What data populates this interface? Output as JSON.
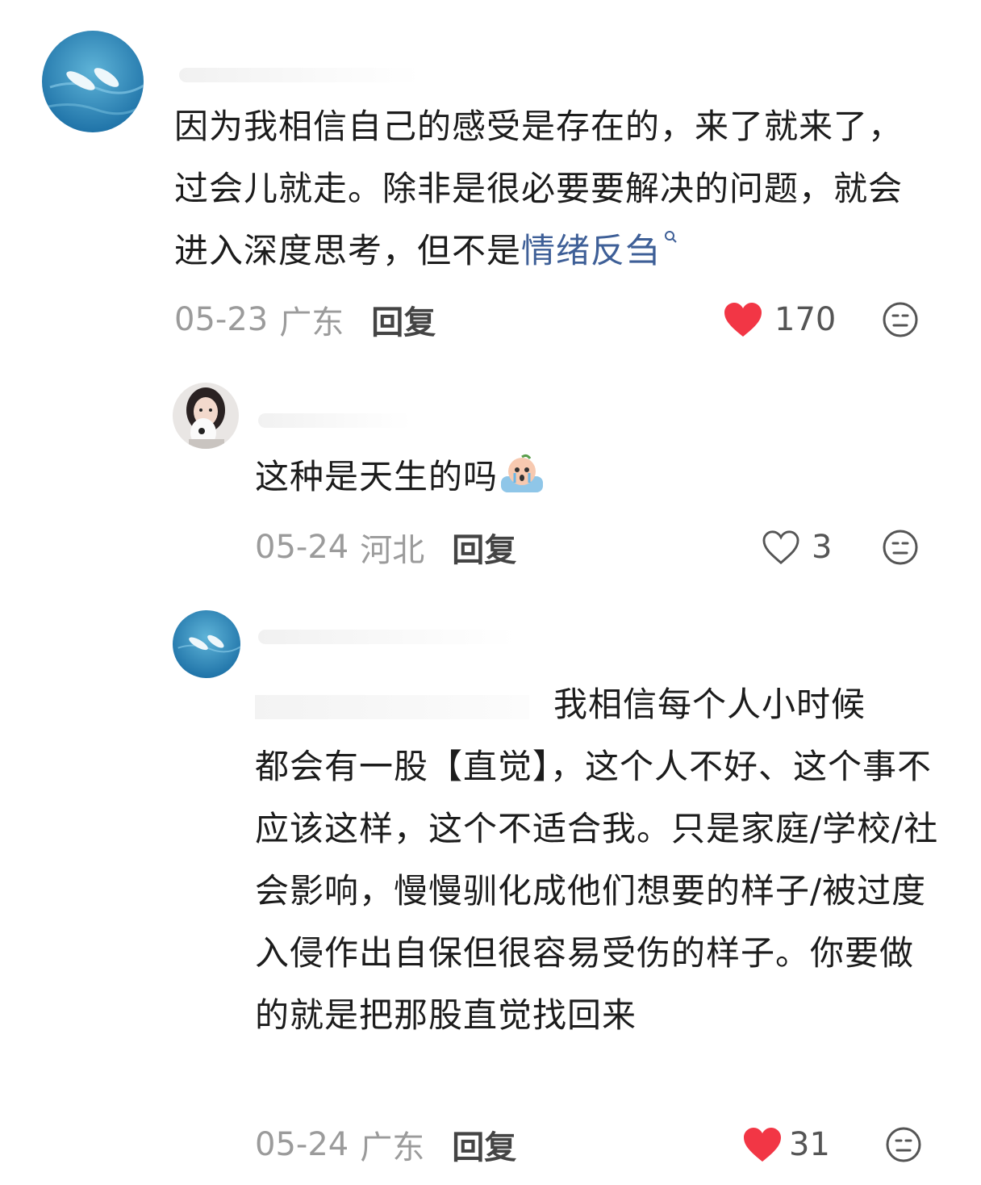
{
  "comments": [
    {
      "text": "因为我相信自己的感受是存在的，来了就来了，过会儿就走。除非是很必要要解决的问题，就会进入深度思考，但不是",
      "link": "情绪反刍",
      "date": "05-23",
      "region": "广东",
      "reply": "回复",
      "likes": "170",
      "liked": true
    },
    {
      "text": "这种是天生的吗",
      "date": "05-24",
      "region": "河北",
      "reply": "回复",
      "likes": "3",
      "liked": false
    },
    {
      "text_line1": "我相信每个人小时候",
      "text_rest": "都会有一股【直觉】，这个人不好、这个事不应该这样，这个不适合我。只是家庭/学校/社会影响，慢慢驯化成他们想要的样子/被过度入侵作出自保但很容易受伤的样子。你要做的就是把那股直觉找回来",
      "date": "05-24",
      "region": "广东",
      "reply": "回复",
      "likes": "31",
      "liked": true
    }
  ],
  "colors": {
    "like_red": "#f23645",
    "link_blue": "#3e5f97",
    "meta_gray": "#9b9b9b"
  },
  "icons": [
    "dolphin-avatar",
    "girl-avatar",
    "heart-icon",
    "heart-outline-icon",
    "dislike-face-icon",
    "crying-emoji-icon",
    "search-icon"
  ]
}
